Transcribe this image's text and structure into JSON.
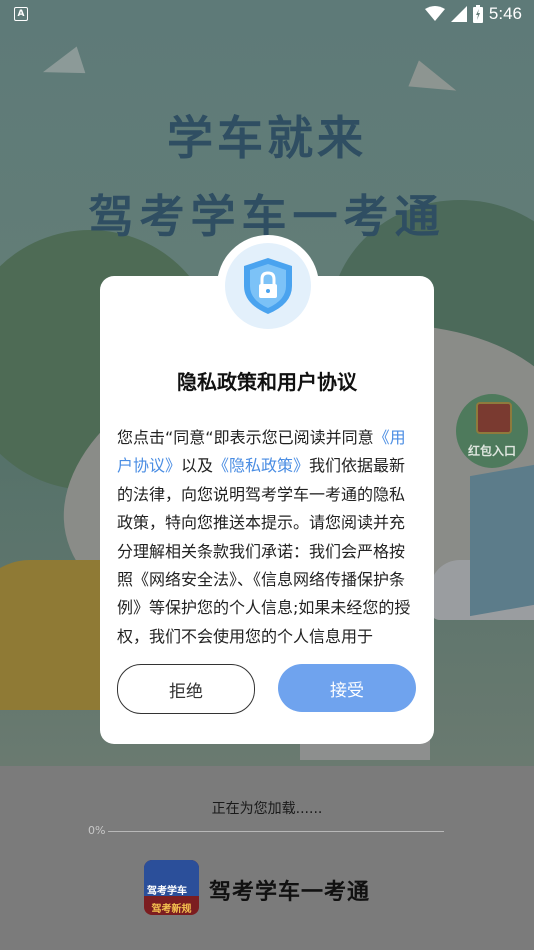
{
  "status_bar": {
    "app_badge": "A",
    "time": "5:46"
  },
  "splash": {
    "title_line1": "学车就来",
    "title_line2": "驾考学车一考通",
    "red_packet_label": "红包入口"
  },
  "dialog": {
    "title": "隐私政策和用户协议",
    "body_prefix": "您点击“同意“即表示您已阅读并同意",
    "user_agreement_link": "《用户协议》",
    "conjunction": "以及",
    "privacy_policy_link": "《隐私政策》",
    "body_rest": "我们依据最新的法律，向您说明驾考学车一考通的隐私政策，特向您推送本提示。请您阅读并充分理解相关条款我们承诺：我们会严格按照《网络安全法》、《信息网络传播保护条例》等保护您的个人信息;如果未经您的授权，我们不会使用您的个人信息用于",
    "decline_label": "拒绝",
    "accept_label": "接受"
  },
  "loading": {
    "text": "正在为您加载......",
    "progress_label": "0%",
    "progress": 0
  },
  "app": {
    "logo_top_text": "驾考学车",
    "logo_bottom_text": "驾考新规",
    "name": "驾考学车一考通"
  },
  "colors": {
    "accent": "#6fa3ee",
    "link": "#4a8de3",
    "overlay": "#7b7b7b"
  }
}
